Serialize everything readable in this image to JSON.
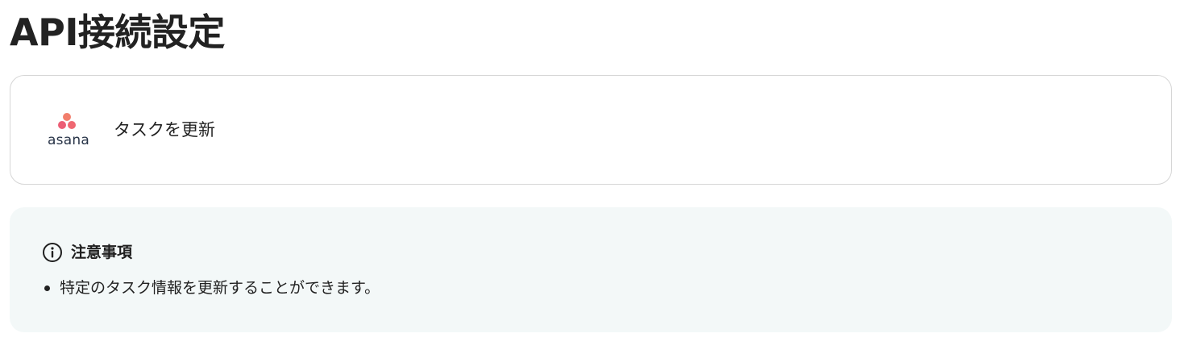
{
  "page": {
    "title": "API接続設定"
  },
  "action_card": {
    "app_logo_text": "asana",
    "app_logo_icon": "asana-logo-icon",
    "label": "タスクを更新"
  },
  "notice": {
    "icon": "info-icon",
    "title": "注意事項",
    "items": [
      "特定のタスク情報を更新することができます。"
    ]
  },
  "colors": {
    "asana_brand": "#f06a6a",
    "notice_background": "#f3f8f8",
    "card_border": "#d6d6d6"
  }
}
